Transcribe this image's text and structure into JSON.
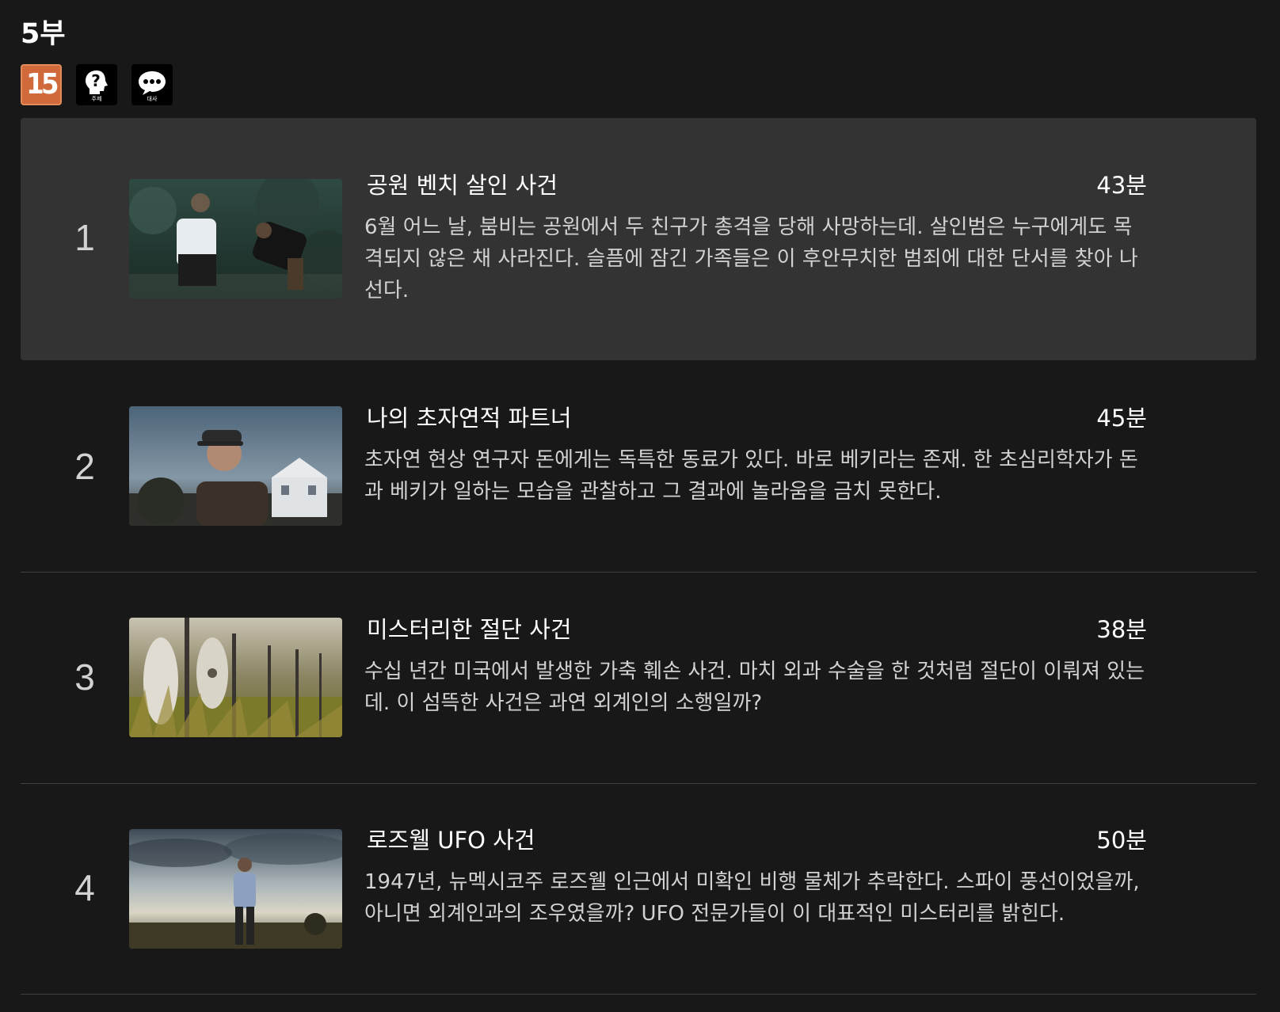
{
  "season": {
    "title": "5부"
  },
  "badges": [
    {
      "icon": "rating-15-icon",
      "text": "15",
      "color": "#d16a3a"
    },
    {
      "icon": "theme-question-icon",
      "caption": "주제"
    },
    {
      "icon": "dialogue-speech-icon",
      "caption": "대사"
    }
  ],
  "episodes": [
    {
      "number": "1",
      "title": "공원 벤치 살인 사건",
      "duration": "43분",
      "description": "6월 어느 날, 붐비는 공원에서 두 친구가 총격을 당해 사망하는데. 살인범은 누구에게도 목격되지 않은 채 사라진다. 슬픔에 잠긴 가족들은 이 후안무치한 범죄에 대한 단서를 찾아 나선다.",
      "active": true
    },
    {
      "number": "2",
      "title": "나의 초자연적 파트너",
      "duration": "45분",
      "description": "초자연 현상 연구자 돈에게는 독특한 동료가 있다. 바로 베키라는 존재. 한 초심리학자가 돈과 베키가 일하는 모습을 관찰하고 그 결과에 놀라움을 금치 못한다.",
      "active": false
    },
    {
      "number": "3",
      "title": "미스터리한 절단 사건",
      "duration": "38분",
      "description": "수십 년간 미국에서 발생한 가축 훼손 사건. 마치 외과 수술을 한 것처럼 절단이 이뤄져 있는데. 이 섬뜩한 사건은 과연 외계인의 소행일까?",
      "active": false
    },
    {
      "number": "4",
      "title": "로즈웰 UFO 사건",
      "duration": "50분",
      "description": "1947년, 뉴멕시코주 로즈웰 인근에서 미확인 비행 물체가 추락한다. 스파이 풍선이었을까, 아니면 외계인과의 조우였을까? UFO 전문가들이 이 대표적인 미스터리를 밝힌다.",
      "active": false
    }
  ],
  "colors": {
    "background": "#181818",
    "active_row": "#333333",
    "divider": "#404040",
    "rating_badge": "#d16a3a"
  }
}
